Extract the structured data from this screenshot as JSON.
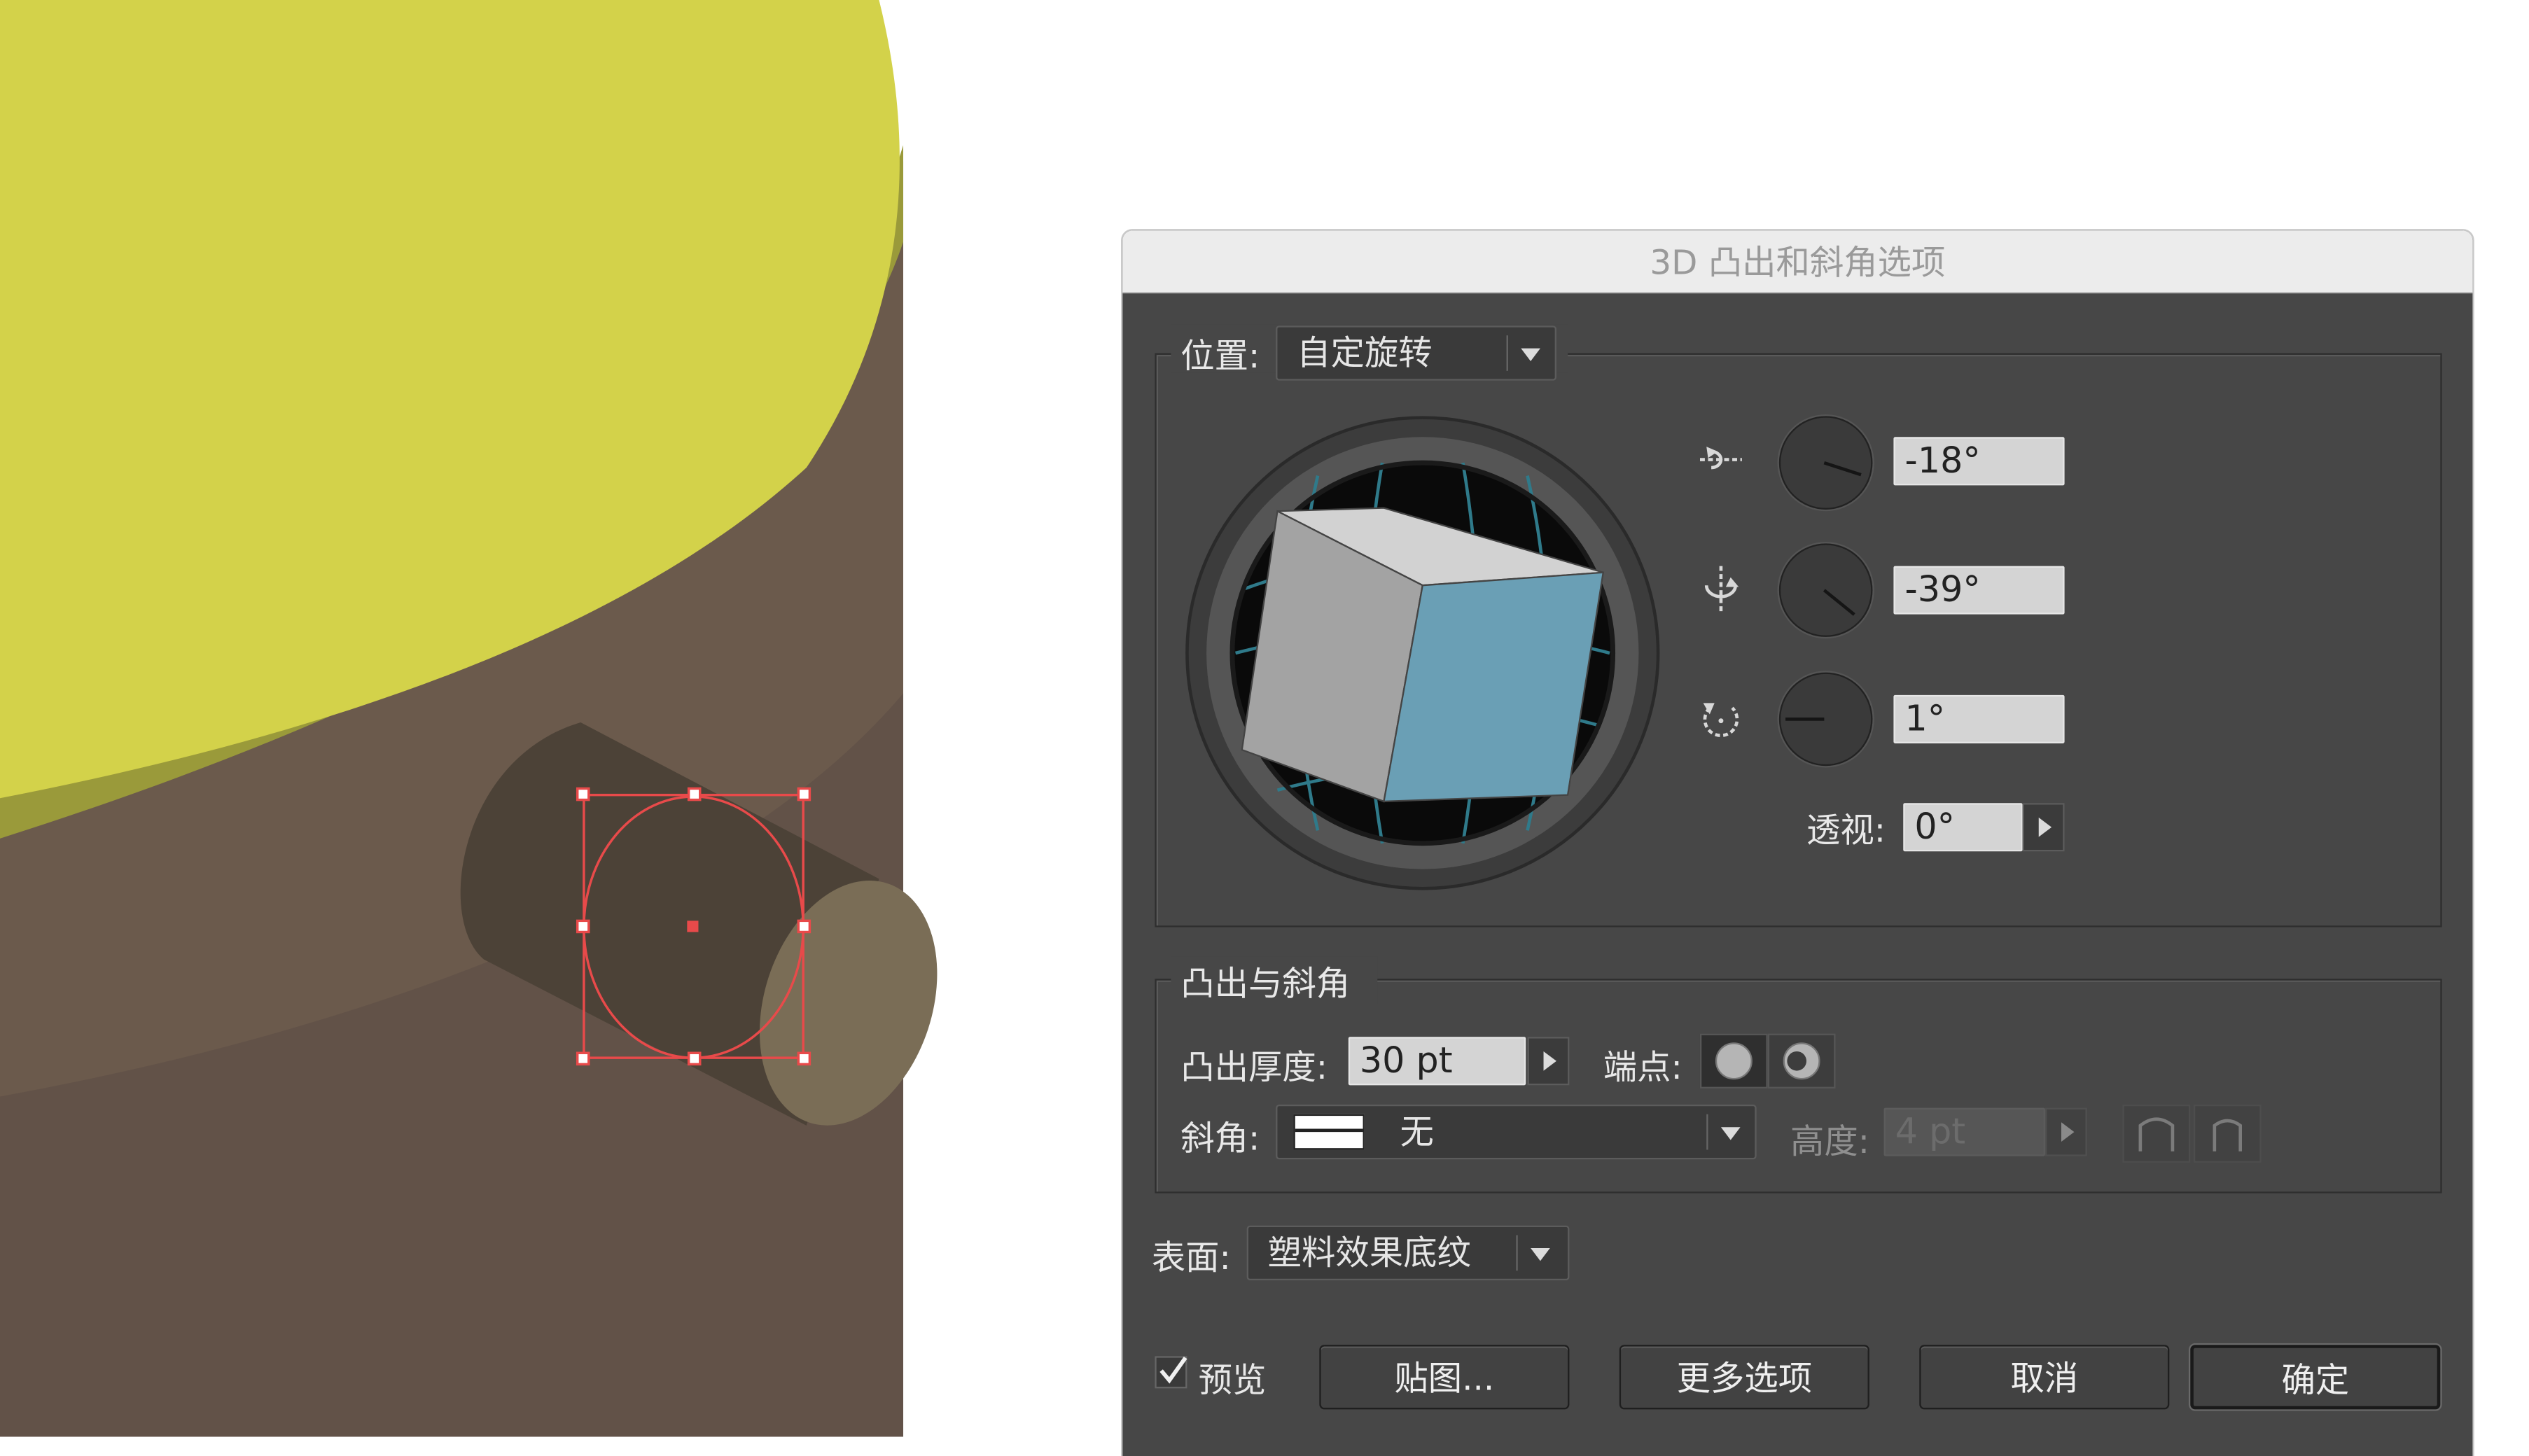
{
  "dialog": {
    "title": "3D 凸出和斜角选项",
    "position": {
      "label": "位置:",
      "value": "自定旋转",
      "rotation_x": {
        "icon": "rotate-x-axis-icon",
        "value": "-18°"
      },
      "rotation_y": {
        "icon": "rotate-y-axis-icon",
        "value": "-39°"
      },
      "rotation_z": {
        "icon": "rotate-z-axis-icon",
        "value": "1°"
      },
      "perspective_label": "透视:",
      "perspective_value": "0°"
    },
    "extrude_bevel": {
      "legend": "凸出与斜角",
      "depth_label": "凸出厚度:",
      "depth_value": "30 pt",
      "cap_label": "端点:",
      "bevel_label": "斜角:",
      "bevel_value": "无",
      "height_label": "高度:",
      "height_value": "4 pt"
    },
    "surface": {
      "label": "表面:",
      "value": "塑料效果底纹"
    },
    "preview": {
      "label": "预览",
      "checked": true
    },
    "buttons": {
      "map": "贴图...",
      "more_options": "更多选项",
      "cancel": "取消",
      "ok": "确定"
    }
  },
  "colors": {
    "dialog_bg": "#474747",
    "cube_front": "#6a9fb5",
    "cube_top": "#d2d2d2",
    "cube_side": "#a3a3a3",
    "selection": "#e84a4a",
    "top_surface": "#d3d24a",
    "side_surface": "#6b5a4c"
  }
}
